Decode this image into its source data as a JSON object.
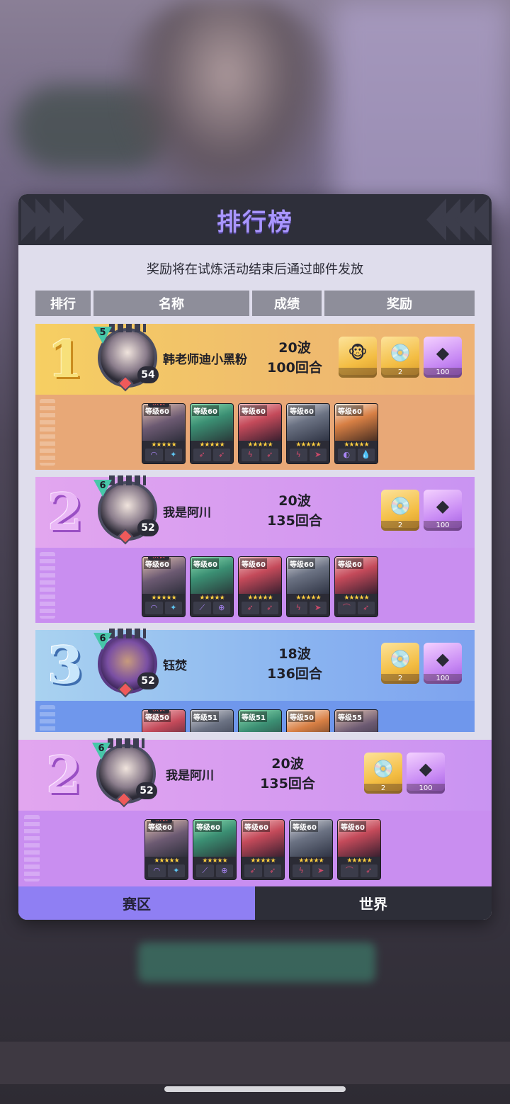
{
  "panel": {
    "title": "排行榜",
    "notice": "奖励将在试炼活动结束后通过邮件发放"
  },
  "columns": {
    "rank": "排行",
    "name": "名称",
    "score": "成绩",
    "reward": "奖励"
  },
  "entries": [
    {
      "rank": "1",
      "avatar_level": "5",
      "player_level": "54",
      "name": "韩老师迪小黑粉",
      "score_waves": "20波",
      "score_rounds": "100回合",
      "rewards": [
        {
          "icon": "monkey-badge-icon",
          "count": ""
        },
        {
          "icon": "record-disc-icon",
          "count": "2"
        },
        {
          "icon": "purple-crystal-icon",
          "count": "100"
        }
      ],
      "heroes": [
        {
          "level": "等级60",
          "captain": "队长"
        },
        {
          "level": "等级60"
        },
        {
          "level": "等级60"
        },
        {
          "level": "等级60"
        },
        {
          "level": "等级60"
        }
      ]
    },
    {
      "rank": "2",
      "avatar_level": "6",
      "player_level": "52",
      "name": "我是阿川",
      "score_waves": "20波",
      "score_rounds": "135回合",
      "rewards": [
        {
          "icon": "record-disc-icon",
          "count": "2"
        },
        {
          "icon": "purple-crystal-icon",
          "count": "100"
        }
      ],
      "heroes": [
        {
          "level": "等级60",
          "captain": "队长"
        },
        {
          "level": "等级60"
        },
        {
          "level": "等级60"
        },
        {
          "level": "等级60"
        },
        {
          "level": "等级60"
        }
      ]
    },
    {
      "rank": "3",
      "avatar_level": "6",
      "player_level": "52",
      "name": "钰焚",
      "score_waves": "18波",
      "score_rounds": "136回合",
      "rewards": [
        {
          "icon": "record-disc-icon",
          "count": "2"
        },
        {
          "icon": "purple-crystal-icon",
          "count": "100"
        }
      ],
      "heroes": [
        {
          "level": "等级50",
          "captain": "队长"
        },
        {
          "level": "等级51"
        },
        {
          "level": "等级51"
        },
        {
          "level": "等级50"
        },
        {
          "level": "等级55"
        }
      ]
    }
  ],
  "self_entry": {
    "rank": "2",
    "avatar_level": "6",
    "player_level": "52",
    "name": "我是阿川",
    "score_waves": "20波",
    "score_rounds": "135回合",
    "rewards": [
      {
        "icon": "record-disc-icon",
        "count": "2"
      },
      {
        "icon": "purple-crystal-icon",
        "count": "100"
      }
    ],
    "heroes": [
      {
        "level": "等级60",
        "captain": "队长"
      },
      {
        "level": "等级60"
      },
      {
        "level": "等级60"
      },
      {
        "level": "等级60"
      },
      {
        "level": "等级60"
      }
    ]
  },
  "tabs": {
    "region": "赛区",
    "world": "世界",
    "active": "region"
  },
  "colors": {
    "accent_purple": "#8f7ff3",
    "title_purple": "#a996ff",
    "gold_row": "#f6cf62",
    "purple_row": "#d59af0",
    "blue_row": "#8ab4f0"
  }
}
